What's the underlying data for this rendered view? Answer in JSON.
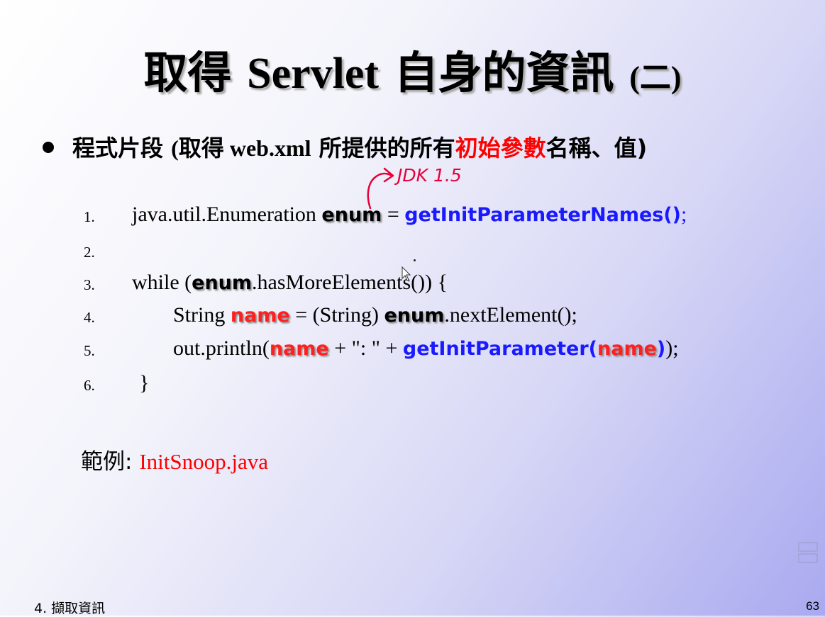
{
  "title": {
    "part1": "取得 ",
    "part2": "Servlet",
    "part3": " 自身的資訊 ",
    "part4": "(二)"
  },
  "bullet": {
    "text1": "程式片段 ",
    "text2": "(取得 ",
    "text3": "web.xml",
    "text4": " 所提供的所有",
    "highlight": "初始參數",
    "text5": "名稱、值)"
  },
  "annotation": "JDK 1.5",
  "code": {
    "numbers": [
      "1.",
      "2.",
      "3.",
      "4.",
      "5.",
      "6."
    ],
    "line1": {
      "a": "java.util.Enumeration  ",
      "enum": "enum",
      "b": "  =  ",
      "method": "getInitParameterNames()",
      "c": ";"
    },
    "line3": {
      "a": "while (",
      "enum": "enum",
      "b": ".hasMoreElements())  {"
    },
    "line4": {
      "a": "String ",
      "name": "name",
      "b": " = (String) ",
      "enum": "enum",
      "c": ".nextElement();"
    },
    "line5": {
      "a": "out.println(",
      "name": "name",
      "b": " + \": \" + ",
      "method": "getInitParameter(",
      "name2": "name",
      "method_close": ")",
      "c": ");"
    },
    "line6": {
      "a": "}"
    }
  },
  "example": {
    "label": "範例: ",
    "file": "InitSnoop.java"
  },
  "footer": {
    "section": "4. 擷取資訊",
    "page": "63"
  },
  "colors": {
    "highlight": "#ff0000",
    "method": "#1a1aff"
  }
}
